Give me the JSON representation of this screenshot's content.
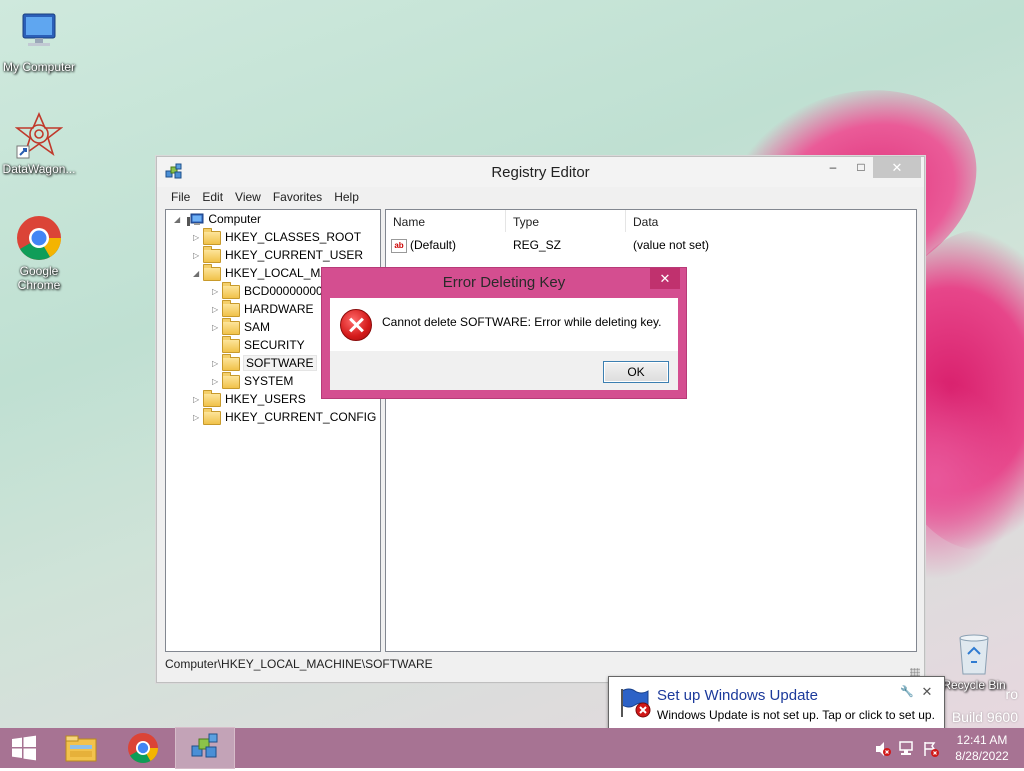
{
  "desktop": {
    "icons": [
      {
        "label": "My Computer"
      },
      {
        "label": "DataWagon..."
      },
      {
        "label": "Google Chrome"
      },
      {
        "label": "Recycle Bin"
      }
    ],
    "watermark": {
      "line1": "ro",
      "line2": "Build 9600"
    }
  },
  "registry_editor": {
    "title": "Registry Editor",
    "window_buttons": {
      "minimize": "–",
      "maximize": "□",
      "close": "✕"
    },
    "menu": [
      "File",
      "Edit",
      "View",
      "Favorites",
      "Help"
    ],
    "tree": {
      "root": "Computer",
      "nodes": [
        {
          "label": "HKEY_CLASSES_ROOT",
          "expander": "▷"
        },
        {
          "label": "HKEY_CURRENT_USER",
          "expander": "▷"
        },
        {
          "label": "HKEY_LOCAL_MACHINE",
          "expander": "◢"
        },
        {
          "label": "BCD00000000",
          "expander": "▷"
        },
        {
          "label": "HARDWARE",
          "expander": "▷"
        },
        {
          "label": "SAM",
          "expander": "▷"
        },
        {
          "label": "SECURITY",
          "expander": ""
        },
        {
          "label": "SOFTWARE",
          "expander": "▷"
        },
        {
          "label": "SYSTEM",
          "expander": "▷"
        },
        {
          "label": "HKEY_USERS",
          "expander": "▷"
        },
        {
          "label": "HKEY_CURRENT_CONFIG",
          "expander": "▷"
        }
      ],
      "root_expander": "◢"
    },
    "columns": [
      "Name",
      "Type",
      "Data"
    ],
    "rows": [
      {
        "name": "(Default)",
        "type": "REG_SZ",
        "data": "(value not set)",
        "icon": "ab"
      }
    ],
    "status_path": "Computer\\HKEY_LOCAL_MACHINE\\SOFTWARE"
  },
  "error_dialog": {
    "title": "Error Deleting Key",
    "close": "✕",
    "message": "Cannot delete SOFTWARE:  Error while deleting key.",
    "ok_label": "OK"
  },
  "notification": {
    "title": "Set up Windows Update",
    "message": "Windows Update is not set up. Tap or click to set up.",
    "pin": "🔧",
    "close": "✕"
  },
  "taskbar": {
    "clock_time": "12:41 AM",
    "clock_date": "8/28/2022"
  },
  "colors": {
    "taskbar": "#a77393",
    "dialog_frame": "#d44e90",
    "link_blue": "#1c3a9b"
  }
}
